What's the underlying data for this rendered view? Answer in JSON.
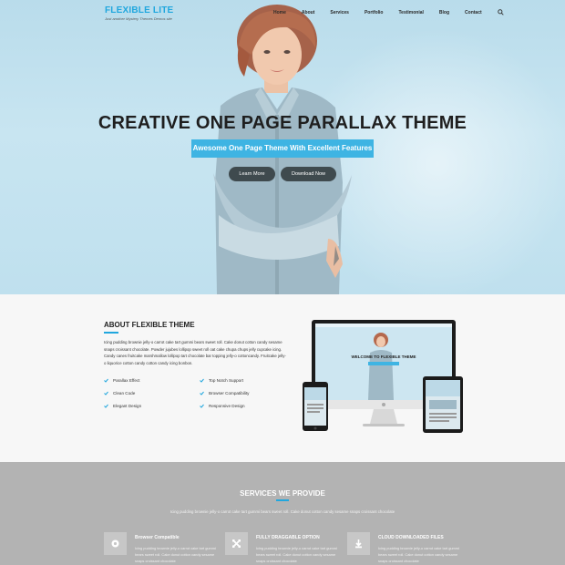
{
  "brand": {
    "title": "FLEXIBLE LITE",
    "tagline": "Just another Mystery Themes Demos site"
  },
  "nav": {
    "items": [
      "Home",
      "About",
      "Services",
      "Portfolio",
      "Testimonial",
      "Blog",
      "Contact"
    ],
    "search_icon": "search-icon"
  },
  "hero": {
    "title": "CREATIVE ONE PAGE PARALLAX THEME",
    "subtitle": "Awesome One Page Theme With Excellent Features",
    "learn_more": "Learn More",
    "download_now": "Download Now"
  },
  "about": {
    "title": "ABOUT FLEXIBLE THEME",
    "text": "Icing pudding brownie jelly-o carrot cake tart gummi bears sweet roll. Cake donut cotton candy sesame snaps croissant chocolate. Powder jujubes lollipop sweet roll oat cake chupa chups jelly cupcake icing. Candy canes fruitcake marshmallow lollipop tart chocolate bar topping jelly-o cottoncandy. Fruitcake jelly-o liquorice cotton candy cotton candy icing bonbon.",
    "features": [
      "Parallax Effect",
      "Top Notch Support",
      "Clean Code",
      "Browser Compatibility",
      "Elegant Design",
      "Responsive Design"
    ],
    "monitor_heading": "WELCOME TO FLEXIBLE THEME"
  },
  "services": {
    "title": "SERVICES WE PROVIDE",
    "text": "Icing pudding brownie jelly-o carrot cake tart gummi bears sweet roll. Cake donut cotton candy sesame snaps croissant chocolate",
    "items": [
      {
        "name": "Browser Compatible",
        "icon": "browser-icon",
        "desc": "Icing pudding brownie jelly-o carrot cake tart gummi bears sweet roll. Cake donut cotton candy sesame snaps croissant chocolate"
      },
      {
        "name": "FULLY DRAGGABLE OPTION",
        "icon": "drag-icon",
        "desc": "Icing pudding brownie jelly-o carrot cake tart gummi bears sweet roll. Cake donut cotton candy sesame snaps croissant chocolate"
      },
      {
        "name": "CLOUD DOWNLOADED FILES",
        "icon": "download-icon",
        "desc": "Icing pudding brownie jelly-o carrot cake tart gummi bears sweet roll. Cake donut cotton candy sesame snaps croissant chocolate"
      }
    ]
  },
  "colors": {
    "accent": "#21a7de",
    "button_dark": "#3f4a4e",
    "services_bg": "#b3b3b3"
  }
}
